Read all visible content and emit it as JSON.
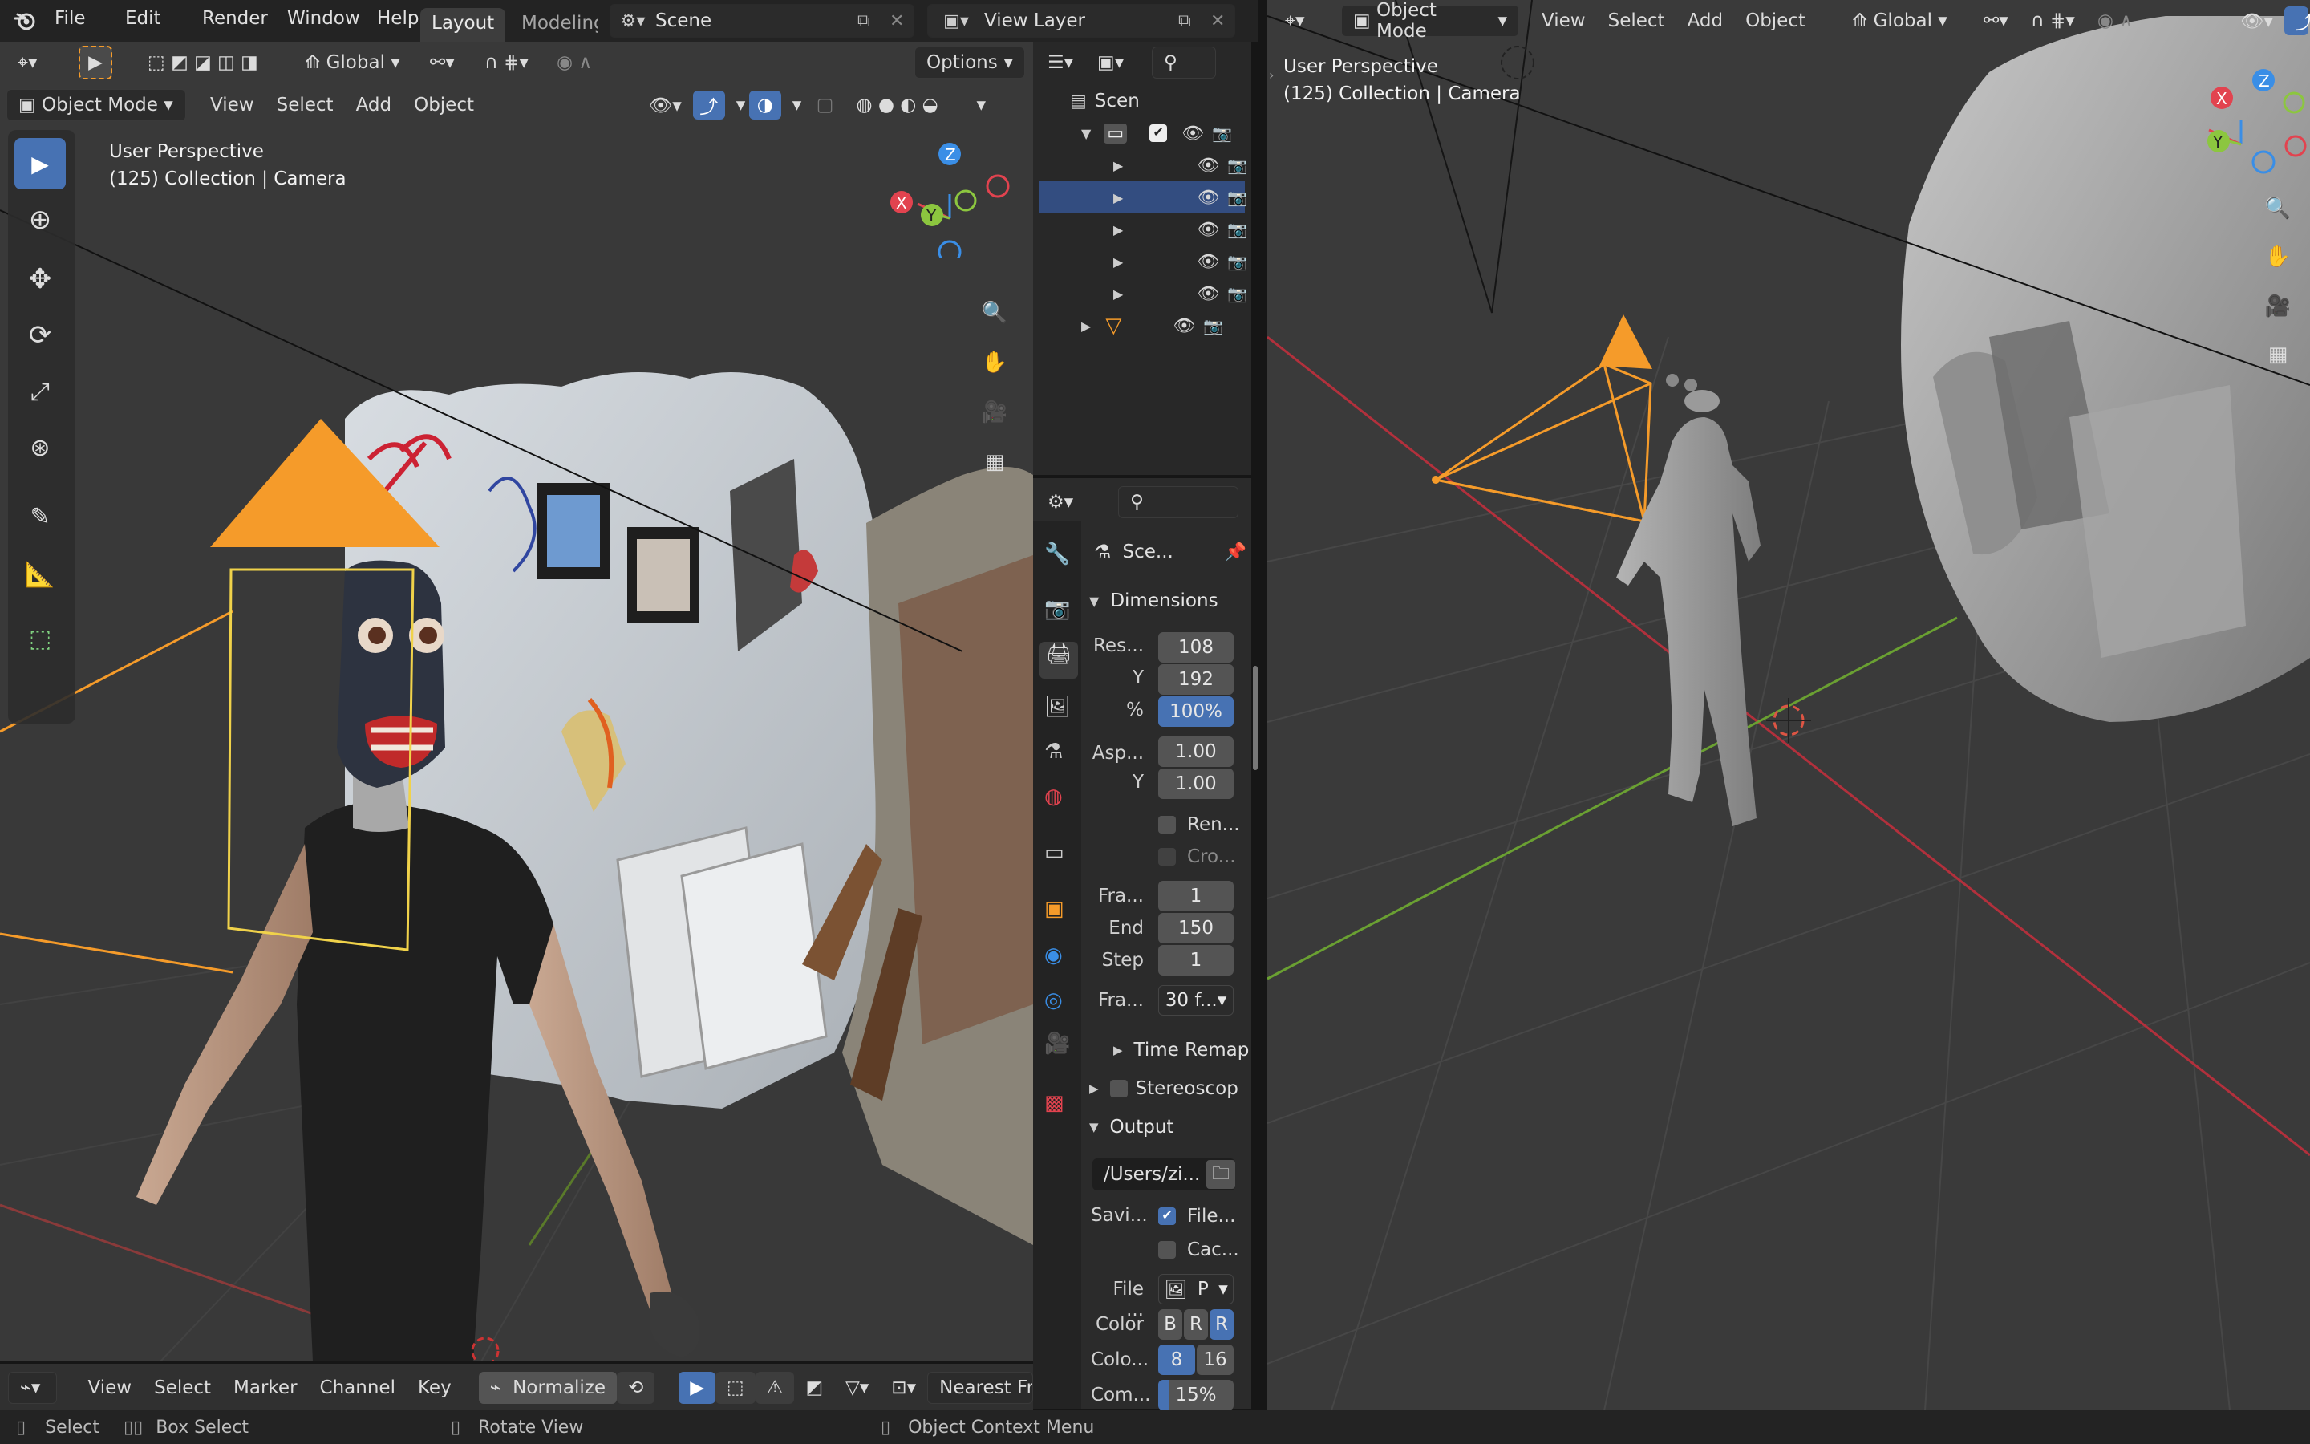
{
  "topbar": {
    "menus": [
      "File",
      "Edit",
      "Render",
      "Window",
      "Help"
    ],
    "workspace_tabs": [
      {
        "label": "Layout",
        "active": true
      },
      {
        "label": "Modeling",
        "active": false
      }
    ],
    "scene_name": "Scene",
    "view_layer": "View Layer"
  },
  "left_viewport": {
    "header": {
      "transform_orientation": "Global",
      "options_label": "Options",
      "mode": "Object Mode",
      "menus": [
        "View",
        "Select",
        "Add",
        "Object"
      ]
    },
    "overlay_text": {
      "perspective": "User Perspective",
      "collection": "(125) Collection | Camera"
    },
    "tools": [
      "select-box",
      "cursor",
      "move",
      "rotate",
      "scale",
      "transform",
      "annotate",
      "measure",
      "add-cube"
    ],
    "gizmo_axes": [
      "X",
      "Y",
      "Z"
    ]
  },
  "outliner": {
    "rows": [
      {
        "label": "Scen",
        "indent": 0,
        "type": "scene"
      },
      {
        "label": "",
        "indent": 1,
        "type": "collection"
      },
      {
        "label": "",
        "indent": 2,
        "type": "object"
      },
      {
        "label": "",
        "indent": 2,
        "type": "object",
        "selected": true
      },
      {
        "label": "",
        "indent": 2,
        "type": "object"
      },
      {
        "label": "",
        "indent": 2,
        "type": "object"
      },
      {
        "label": "",
        "indent": 2,
        "type": "object"
      },
      {
        "label": "",
        "indent": 1,
        "type": "camera"
      }
    ]
  },
  "properties": {
    "scene_label": "Sce...",
    "dimensions": {
      "title": "Dimensions",
      "res_x_label": "Res...",
      "res_x": "108",
      "res_y_label": "Y",
      "res_y": "192",
      "pct_label": "%",
      "pct": "100%",
      "asp_x_label": "Asp...",
      "asp_x": "1.00",
      "asp_y_label": "Y",
      "asp_y": "1.00",
      "render_region": "Ren...",
      "crop": "Cro...",
      "frame_start_label": "Fra...",
      "frame_start": "1",
      "frame_end_label": "End",
      "frame_end": "150",
      "step_label": "Step",
      "step": "1",
      "fps_label": "Fra...",
      "fps": "30 f..."
    },
    "time_remap": "Time Remap",
    "stereoscopy": "Stereoscop",
    "output": {
      "title": "Output",
      "path": "/Users/zi...",
      "saving_label": "Savi...",
      "file_ext": "File...",
      "cache": "Cac...",
      "file_format_label": "File ...",
      "file_format": "P",
      "color_label": "Color",
      "color_modes": [
        "B",
        "R",
        "R"
      ],
      "color_depth_label": "Colo...",
      "color_depths": [
        "8",
        "16"
      ],
      "compression_label": "Com...",
      "compression": "15%"
    }
  },
  "timeline": {
    "menus": [
      "View",
      "Select",
      "Marker",
      "Channel",
      "Key"
    ],
    "normalize": "Normalize",
    "interpolation": "Nearest Fra"
  },
  "right_viewport": {
    "header": {
      "mode": "Object Mode",
      "menus": [
        "View",
        "Select",
        "Add",
        "Object"
      ],
      "transform_orientation": "Global"
    },
    "overlay_text": {
      "perspective": "User Perspective",
      "collection": "(125) Collection | Camera"
    },
    "gizmo_axes": [
      "X",
      "Y",
      "Z"
    ]
  },
  "statusbar": {
    "items": [
      "Select",
      "Box Select",
      "Rotate View",
      "Object Context Menu"
    ]
  },
  "colors": {
    "accent": "#4772b3",
    "camera": "#f59b2a",
    "axis_x": "#e2434f",
    "axis_y": "#8cc63f",
    "axis_z": "#3a8ee6"
  }
}
